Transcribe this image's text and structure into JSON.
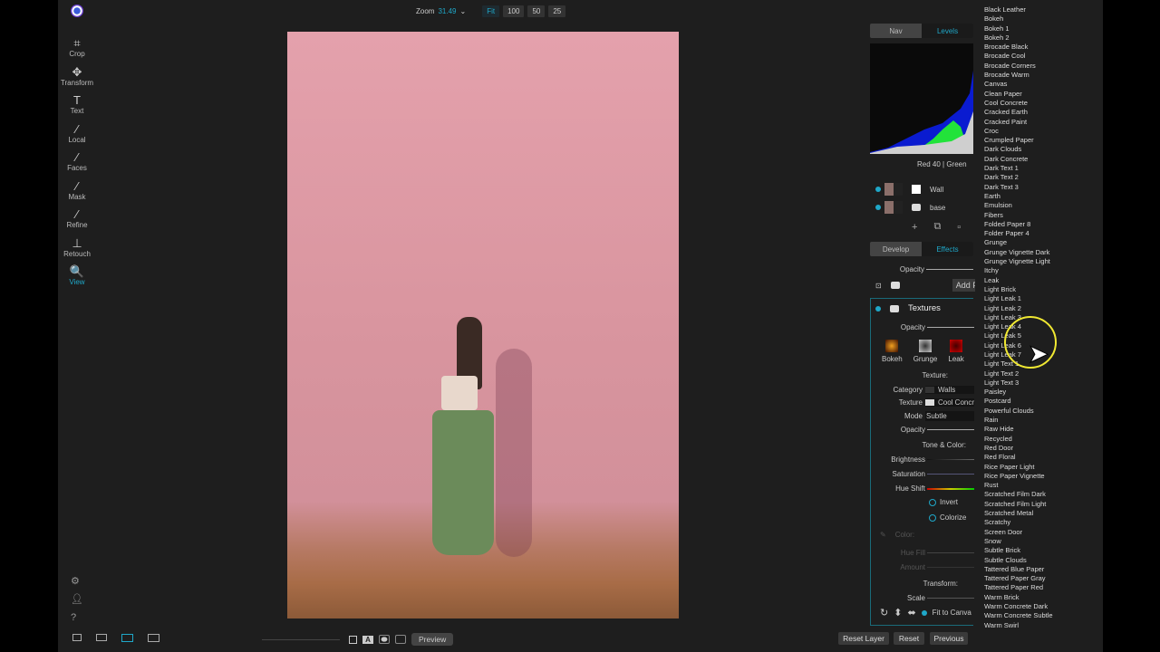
{
  "tools": [
    {
      "label": "Crop",
      "icon": "crop-icon",
      "glyph": "⌗"
    },
    {
      "label": "Transform",
      "icon": "move-icon",
      "glyph": "✥"
    },
    {
      "label": "Text",
      "icon": "text-icon",
      "glyph": "T"
    },
    {
      "label": "Local",
      "icon": "brush-icon",
      "glyph": "⁄"
    },
    {
      "label": "Faces",
      "icon": "faces-brush-icon",
      "glyph": "⁄"
    },
    {
      "label": "Mask",
      "icon": "mask-brush-icon",
      "glyph": "⁄"
    },
    {
      "label": "Refine",
      "icon": "refine-brush-icon",
      "glyph": "⁄"
    },
    {
      "label": "Retouch",
      "icon": "stamp-icon",
      "glyph": "⊥"
    },
    {
      "label": "View",
      "icon": "view-icon",
      "glyph": "🔍"
    }
  ],
  "zoom": {
    "label": "Zoom",
    "value": "31.49",
    "buttons": [
      "Fit",
      "100",
      "50",
      "25"
    ]
  },
  "bottom": {
    "preview": "Preview",
    "reset_layer": "Reset Layer",
    "reset": "Reset",
    "previous": "Previous"
  },
  "nav_tabs": [
    "Nav",
    "Levels"
  ],
  "histogram_readout": "Red  40  | Green",
  "layers": [
    {
      "name": "Wall"
    },
    {
      "name": "base"
    }
  ],
  "panel_tabs": [
    "Develop",
    "Effects"
  ],
  "opacity_label": "Opacity",
  "add_filter": "Add Fi",
  "textures": {
    "title": "Textures",
    "opacity": "Opacity",
    "presets": [
      "Bokeh",
      "Grunge",
      "Leak"
    ],
    "texture_header": "Texture:",
    "category_label": "Category",
    "category": "Walls",
    "texture_label": "Texture",
    "texture": "Cool Concr",
    "mode_label": "Mode",
    "mode": "Subtle",
    "opacity2": "Opacity",
    "tone_header": "Tone & Color:",
    "brightness": "Brightness",
    "saturation": "Saturation",
    "hue_shift": "Hue Shift",
    "invert": "Invert",
    "colorize": "Colorize",
    "color": "Color:",
    "hue_fill": "Hue Fill",
    "amount": "Amount",
    "transform_header": "Transform:",
    "scale": "Scale",
    "fit": "Fit to Canva"
  },
  "dropdown": [
    "Black Leather",
    "Bokeh",
    "Bokeh 1",
    "Bokeh 2",
    "Brocade Black",
    "Brocade Cool",
    "Brocade Corners",
    "Brocade Warm",
    "Canvas",
    "Clean Paper",
    "Cool Concrete",
    "Cracked Earth",
    "Cracked Paint",
    "Croc",
    "Crumpled Paper",
    "Dark Clouds",
    "Dark Concrete",
    "Dark Text 1",
    "Dark Text 2",
    "Dark Text 3",
    "Earth",
    "Emulsion",
    "Fibers",
    "Folded Paper 8",
    "Folder Paper 4",
    "Grunge",
    "Grunge Vignette Dark",
    "Grunge Vignette Light",
    "Itchy",
    "Leak",
    "Light Brick",
    "Light Leak 1",
    "Light Leak 2",
    "Light Leak 3",
    "Light Leak 4",
    "Light Leak 5",
    "Light Leak 6",
    "Light Leak 7",
    "Light Text 1",
    "Light Text 2",
    "Light Text 3",
    "Paisley",
    "Postcard",
    "Powerful Clouds",
    "Rain",
    "Raw Hide",
    "Recycled",
    "Red Door",
    "Red Floral",
    "Rice Paper Light",
    "Rice Paper Vignette",
    "Rust",
    "Scratched Film Dark",
    "Scratched Film Light",
    "Scratched Metal",
    "Scratchy",
    "Screen Door",
    "Snow",
    "Subtle Brick",
    "Subtle Clouds",
    "Tattered Blue Paper",
    "Tattered Paper Gray",
    "Tattered Paper Red",
    "Warm Brick",
    "Warm Concrete Dark",
    "Warm Concrete Subtle",
    "Warm Swirl"
  ],
  "colors": {
    "accent": "#1fa8c9",
    "cursor_highlight": "#f0e832"
  }
}
